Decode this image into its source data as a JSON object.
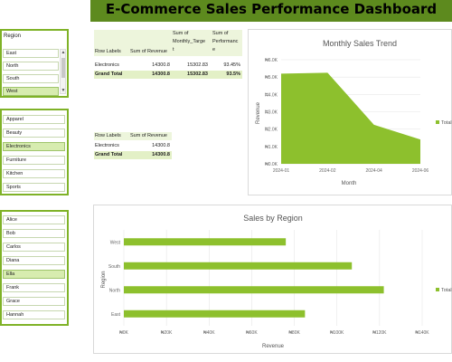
{
  "dashboard": {
    "title": "E-Commerce Sales Performance Dashboard"
  },
  "colors": {
    "accent": "#7fb227",
    "banner": "#5d8a1e",
    "selected": "#d7ecaf"
  },
  "slicers": {
    "region": {
      "header": "Region",
      "items": [
        "East",
        "North",
        "South",
        "West"
      ],
      "selected": "West"
    },
    "category": {
      "items": [
        "Apparel",
        "Beauty",
        "Electronics",
        "Furniture",
        "Kitchen",
        "Sports"
      ],
      "selected": "Electronics"
    },
    "salesperson": {
      "items": [
        "Alice",
        "Bob",
        "Carlos",
        "Diana",
        "Ella",
        "Frank",
        "Grace",
        "Hannah"
      ],
      "selected": "Ella"
    }
  },
  "pivot1": {
    "headers": {
      "row_labels": "Row Labels",
      "revenue": "Sum of Revenue",
      "target_line1": "Sum of",
      "target_line2": "Monthly_Targe",
      "target_line3": "t",
      "perf_line1": "Sum of",
      "perf_line2": "Performanc",
      "perf_line3": "e"
    },
    "rows": [
      {
        "label": "Electronics",
        "revenue": "14300.8",
        "target": "15302.83",
        "perf": "93.45%"
      }
    ],
    "total": {
      "label": "Grand Total",
      "revenue": "14300.8",
      "target": "15302.83",
      "perf": "93.5%"
    }
  },
  "pivot2": {
    "headers": {
      "row_labels": "Row Labels",
      "revenue": "Sum of Revenue"
    },
    "rows": [
      {
        "label": "Electronics",
        "revenue": "14300.8"
      }
    ],
    "total": {
      "label": "Grand Total",
      "revenue": "14300.8"
    }
  },
  "chart_data": [
    {
      "type": "area",
      "title": "Monthly Sales Trend",
      "xlabel": "Month",
      "ylabel": "Revenue",
      "x": [
        "2024-01",
        "2024-02",
        "2024-04",
        "2024-06"
      ],
      "series": [
        {
          "name": "Total",
          "values": [
            5200,
            5250,
            2250,
            1400
          ]
        }
      ],
      "ylim": [
        0,
        6000
      ],
      "yticks": [
        "₦0.0K",
        "₦1.0K",
        "₦2.0K",
        "₦3.0K",
        "₦4.0K",
        "₦5.0K",
        "₦6.0K"
      ],
      "legend": "right",
      "color": "#8dc02d"
    },
    {
      "type": "bar",
      "orientation": "horizontal",
      "title": "Sales by Region",
      "xlabel": "Revenue",
      "ylabel": "Region",
      "categories": [
        "West",
        "South",
        "North",
        "East"
      ],
      "series": [
        {
          "name": "Total",
          "values": [
            76000,
            107000,
            122000,
            85000
          ]
        }
      ],
      "xlim": [
        0,
        140000
      ],
      "xticks": [
        "₦0K",
        "₦20K",
        "₦40K",
        "₦60K",
        "₦80K",
        "₦100K",
        "₦120K",
        "₦140K"
      ],
      "legend": "right",
      "color": "#8dc02d"
    }
  ]
}
